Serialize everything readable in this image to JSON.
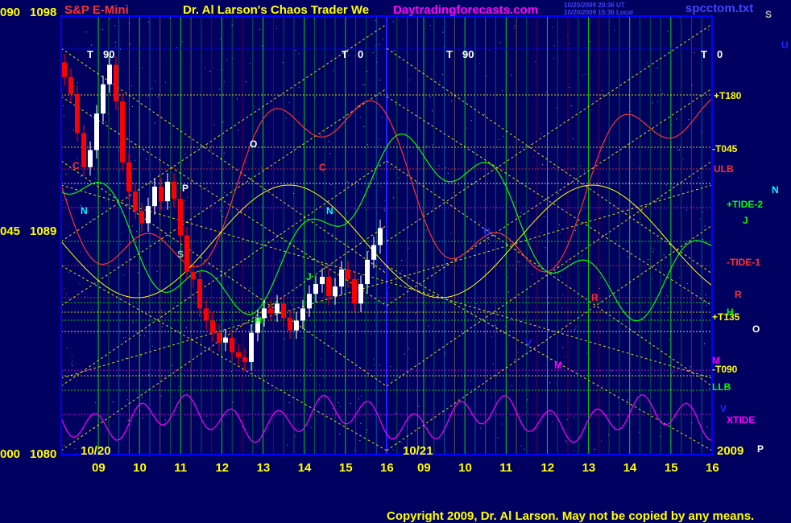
{
  "header": {
    "symbol": "S&P E-Mini",
    "title": "Dr. Al Larson's Chaos Trader We",
    "website": "Daytradingforecasts.com",
    "time_line1": "10/20/2009 20:36 UT",
    "time_line2": "10/20/2009 15:36 Local",
    "file": "spcctom.txt"
  },
  "footer": {
    "copyright": "Copyright 2009, Dr. Al Larson. May not be copied by any means."
  },
  "colors": {
    "background": "#000060",
    "frame": "#0000ff",
    "grid": "#00ff00",
    "trendline": "#ffff00",
    "up_bar": "#ffffff",
    "down_bar": "#ff0000",
    "symbol_text": "#ff3030",
    "website_text": "#ff00ff",
    "copyright_text": "#ffff00"
  },
  "chart_data": {
    "type": "candlestick",
    "title": "S&P E-Mini",
    "x_ticks": [
      "09",
      "10",
      "11",
      "12",
      "13",
      "14",
      "15",
      "16",
      "09",
      "10",
      "11",
      "12",
      "13",
      "14",
      "15",
      "16"
    ],
    "date_labels": [
      "10/20",
      "10/21"
    ],
    "year_label": "2009",
    "y_ticks": [
      {
        "left": "090",
        "price": 1098
      },
      {
        "left": "045",
        "price": 1089
      },
      {
        "left": "000",
        "price": 1080
      }
    ],
    "ylim": [
      1080,
      1098
    ],
    "column_labels": [
      "T",
      "90",
      "T",
      "0",
      "T",
      "90",
      "T",
      "0"
    ],
    "right_labels": [
      {
        "text": "+T180",
        "color": "#ffff00"
      },
      {
        "text": "-T045",
        "color": "#ffff00"
      },
      {
        "text": "ULB",
        "color": "#ff3030"
      },
      {
        "text": "+TIDE-2",
        "color": "#00ff00"
      },
      {
        "text": "-TIDE-1",
        "color": "#ff3030"
      },
      {
        "text": "+T135",
        "color": "#ffff00"
      },
      {
        "text": "-T090",
        "color": "#ffff00"
      },
      {
        "text": "LLB",
        "color": "#00ff00"
      },
      {
        "text": "XTIDE",
        "color": "#ff00ff"
      },
      {
        "text": "R",
        "color": "#ff3030"
      },
      {
        "text": "M",
        "color": "#ff00ff"
      },
      {
        "text": "N",
        "color": "#00ffff"
      },
      {
        "text": "J",
        "color": "#00ff00"
      },
      {
        "text": "H",
        "color": "#00ff00"
      },
      {
        "text": "O",
        "color": "#ffffff"
      },
      {
        "text": "P",
        "color": "#ffffff"
      },
      {
        "text": "S",
        "color": "#bbbbbb"
      },
      {
        "text": "U",
        "color": "#2222ff"
      },
      {
        "text": "V",
        "color": "#2222ff"
      }
    ],
    "planet_markers": [
      "C",
      "N",
      "P",
      "S",
      "O",
      "C",
      "N",
      "H",
      "J",
      "R",
      "M",
      "U",
      "V"
    ],
    "price_close": [
      1095.5,
      1094.8,
      1093.2,
      1091.8,
      1092.5,
      1094.0,
      1095.2,
      1096.0,
      1094.5,
      1092.0,
      1090.8,
      1090.0,
      1089.5,
      1090.2,
      1091.0,
      1090.4,
      1091.2,
      1090.5,
      1089.0,
      1087.5,
      1087.2,
      1086.0,
      1085.5,
      1085.0,
      1084.6,
      1084.8,
      1084.2,
      1084.0,
      1083.8,
      1085.0,
      1085.6,
      1086.0,
      1085.8,
      1086.2,
      1085.6,
      1085.1,
      1085.5,
      1086.0,
      1086.6,
      1087.0,
      1087.3,
      1086.5,
      1086.9,
      1087.6,
      1087.2,
      1086.2,
      1087.0,
      1088.0,
      1088.6,
      1089.3
    ]
  }
}
